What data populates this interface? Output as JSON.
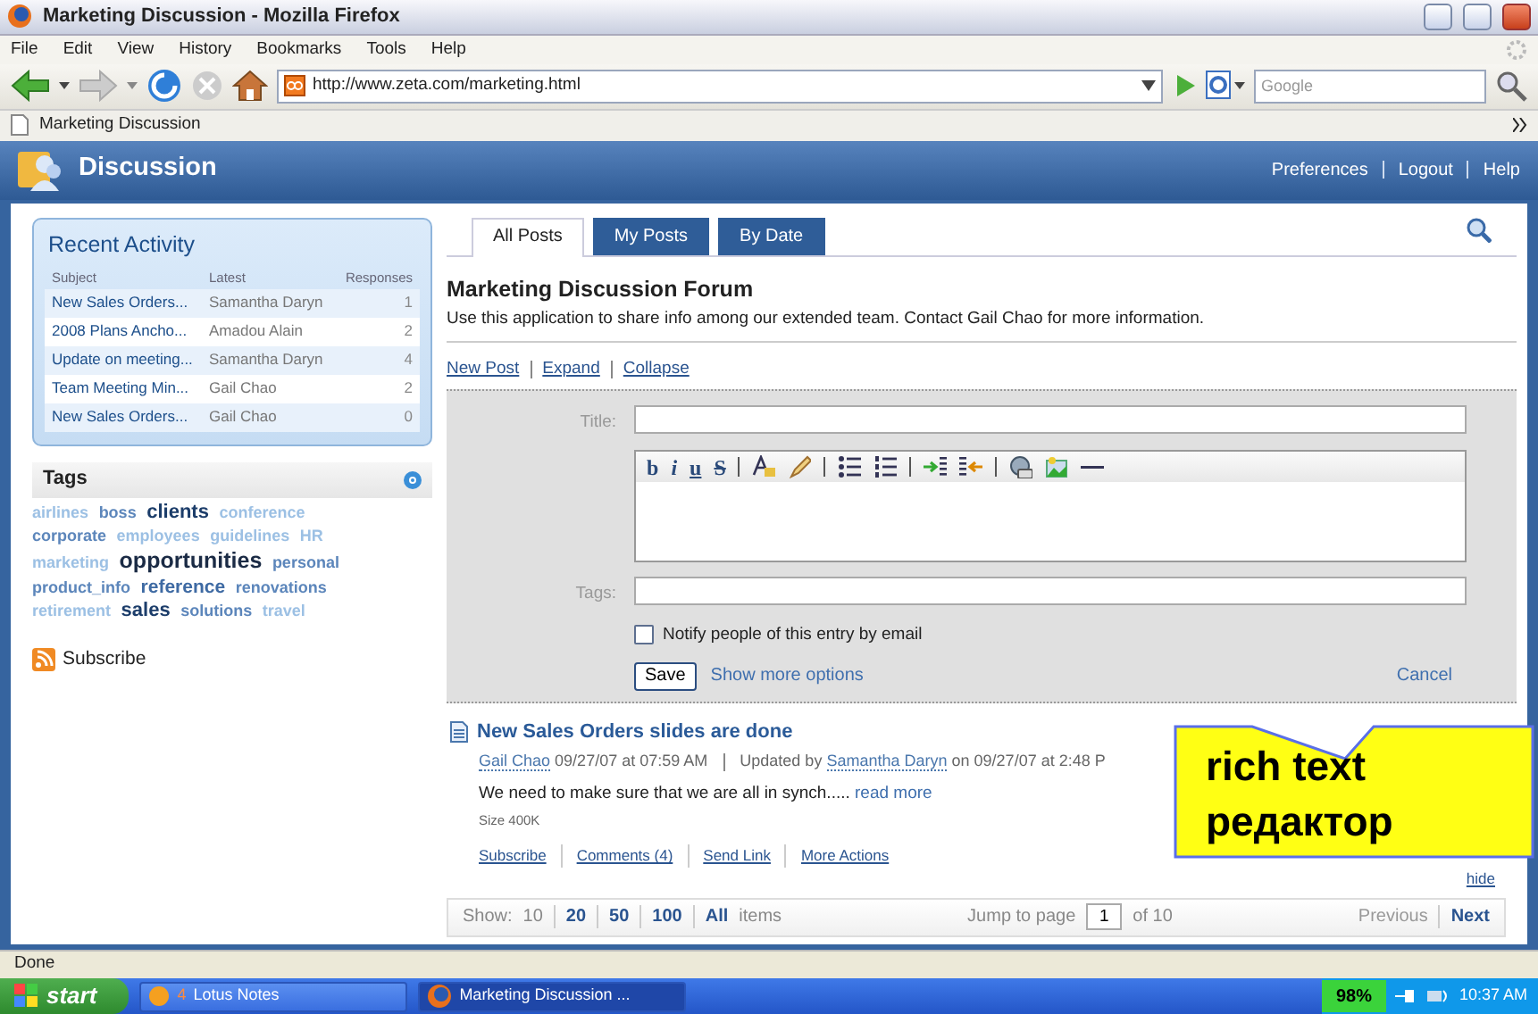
{
  "window": {
    "title": "Marketing Discussion - Mozilla Firefox"
  },
  "menu": [
    "File",
    "Edit",
    "View",
    "History",
    "Bookmarks",
    "Tools",
    "Help"
  ],
  "address_bar": {
    "url": "http://www.zeta.com/marketing.html"
  },
  "search_field": {
    "placeholder": "Google"
  },
  "browser_tabs": [
    {
      "title": "Marketing Discussion"
    }
  ],
  "app": {
    "title": "Discussion",
    "header_links": [
      "Preferences",
      "Logout",
      "Help"
    ]
  },
  "recent_activity": {
    "title": "Recent Activity",
    "columns": [
      "Subject",
      "Latest",
      "Responses"
    ],
    "rows": [
      {
        "subject": "New Sales Orders...",
        "latest": "Samantha Daryn",
        "responses": "1"
      },
      {
        "subject": "2008 Plans Ancho...",
        "latest": "Amadou Alain",
        "responses": "2"
      },
      {
        "subject": "Update on meeting...",
        "latest": "Samantha Daryn",
        "responses": "4"
      },
      {
        "subject": "Team Meeting Min...",
        "latest": "Gail Chao",
        "responses": "2"
      },
      {
        "subject": "New Sales Orders...",
        "latest": "Gail Chao",
        "responses": "0"
      }
    ]
  },
  "tags": {
    "title": "Tags",
    "items": [
      {
        "label": "airlines",
        "kind": "faint"
      },
      {
        "label": "boss",
        "kind": "normal"
      },
      {
        "label": "clients",
        "kind": "big"
      },
      {
        "label": "conference",
        "kind": "faint"
      },
      {
        "label": "corporate",
        "kind": "normal"
      },
      {
        "label": "employees",
        "kind": "faint"
      },
      {
        "label": "guidelines",
        "kind": "faint"
      },
      {
        "label": "HR",
        "kind": "faint"
      },
      {
        "label": "marketing",
        "kind": "faint"
      },
      {
        "label": "opportunities",
        "kind": "huge"
      },
      {
        "label": "personal",
        "kind": "normal"
      },
      {
        "label": "product_info",
        "kind": "normal"
      },
      {
        "label": "reference",
        "kind": "large"
      },
      {
        "label": "renovations",
        "kind": "normal"
      },
      {
        "label": "retirement",
        "kind": "faint"
      },
      {
        "label": "sales",
        "kind": "big"
      },
      {
        "label": "solutions",
        "kind": "normal"
      },
      {
        "label": "travel",
        "kind": "faint"
      }
    ]
  },
  "subscribe": "Subscribe",
  "tabs": [
    {
      "label": "All Posts",
      "selected": true
    },
    {
      "label": "My Posts",
      "selected": false
    },
    {
      "label": "By Date",
      "selected": false
    }
  ],
  "forum": {
    "title": "Marketing Discussion Forum",
    "description": "Use this application to share info among our extended team. Contact Gail Chao for more information."
  },
  "actions": [
    "New Post",
    "Expand",
    "Collapse"
  ],
  "form": {
    "title_label": "Title:",
    "tags_label": "Tags:",
    "format_buttons": [
      "b",
      "i",
      "u",
      "S"
    ],
    "notify": {
      "label": "Notify people of this entry by email",
      "checked": false
    },
    "save": "Save",
    "more": "Show more options",
    "cancel": "Cancel"
  },
  "post": {
    "title": "New Sales Orders slides are done",
    "author": "Gail Chao",
    "posted": "09/27/07 at 07:59 AM",
    "updated_label": "Updated by",
    "updater": "Samantha Daryn",
    "updated": "on 09/27/07 at 2:48 P",
    "excerpt": "We need to make sure that we are all in synch.....",
    "read_more": "read more",
    "size": "Size 400K",
    "actions": [
      "Subscribe",
      "Comments (4)",
      "Send Link",
      "More Actions"
    ],
    "hide": "hide"
  },
  "pager": {
    "show_label": "Show:",
    "sizes": [
      {
        "label": "10",
        "selected": true
      },
      {
        "label": "20",
        "selected": false
      },
      {
        "label": "50",
        "selected": false
      },
      {
        "label": "100",
        "selected": false
      },
      {
        "label": "All",
        "selected": false
      }
    ],
    "items_label": "items",
    "jump_label": "Jump to page",
    "page": "1",
    "of_label": "of 10",
    "previous": {
      "label": "Previous",
      "disabled": true
    },
    "next": {
      "label": "Next",
      "disabled": false
    }
  },
  "callout": {
    "lines": [
      "rich text",
      "редактор"
    ]
  },
  "status_bar": "Done",
  "taskbar": {
    "start": "start",
    "items": [
      {
        "count": "4",
        "label": "Lotus Notes",
        "selected": false
      },
      {
        "label": "Marketing Discussion ...",
        "selected": true
      }
    ],
    "battery": "98%",
    "clock": "10:37 AM"
  }
}
